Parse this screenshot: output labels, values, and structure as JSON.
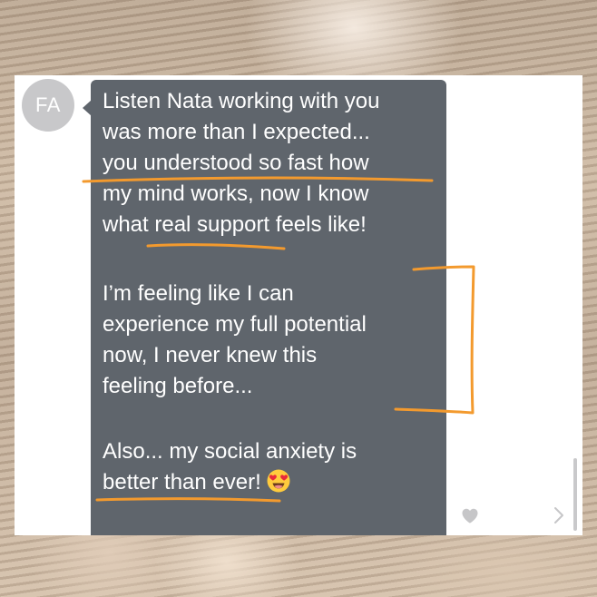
{
  "contact": {
    "initials": "FA"
  },
  "message": {
    "paragraph_1": "Listen Nata working with you\nwas more than I expected...\nyou understood so fast how\nmy mind works, now I know\nwhat real support feels like!",
    "paragraph_2": "I’m feeling like I can\nexperience my full potential\nnow, I never knew this\nfeeling before...",
    "paragraph_3": "Also... my social anxiety is\nbetter than ever!",
    "emoji": "heart-eyes-emoji"
  },
  "icons": {
    "like": "heart-icon",
    "next": "chevron-right-icon"
  },
  "colors": {
    "bubble": "#5f656c",
    "avatar": "#c8c8ca",
    "highlight_marker": "#f39a2e",
    "card": "#ffffff"
  }
}
